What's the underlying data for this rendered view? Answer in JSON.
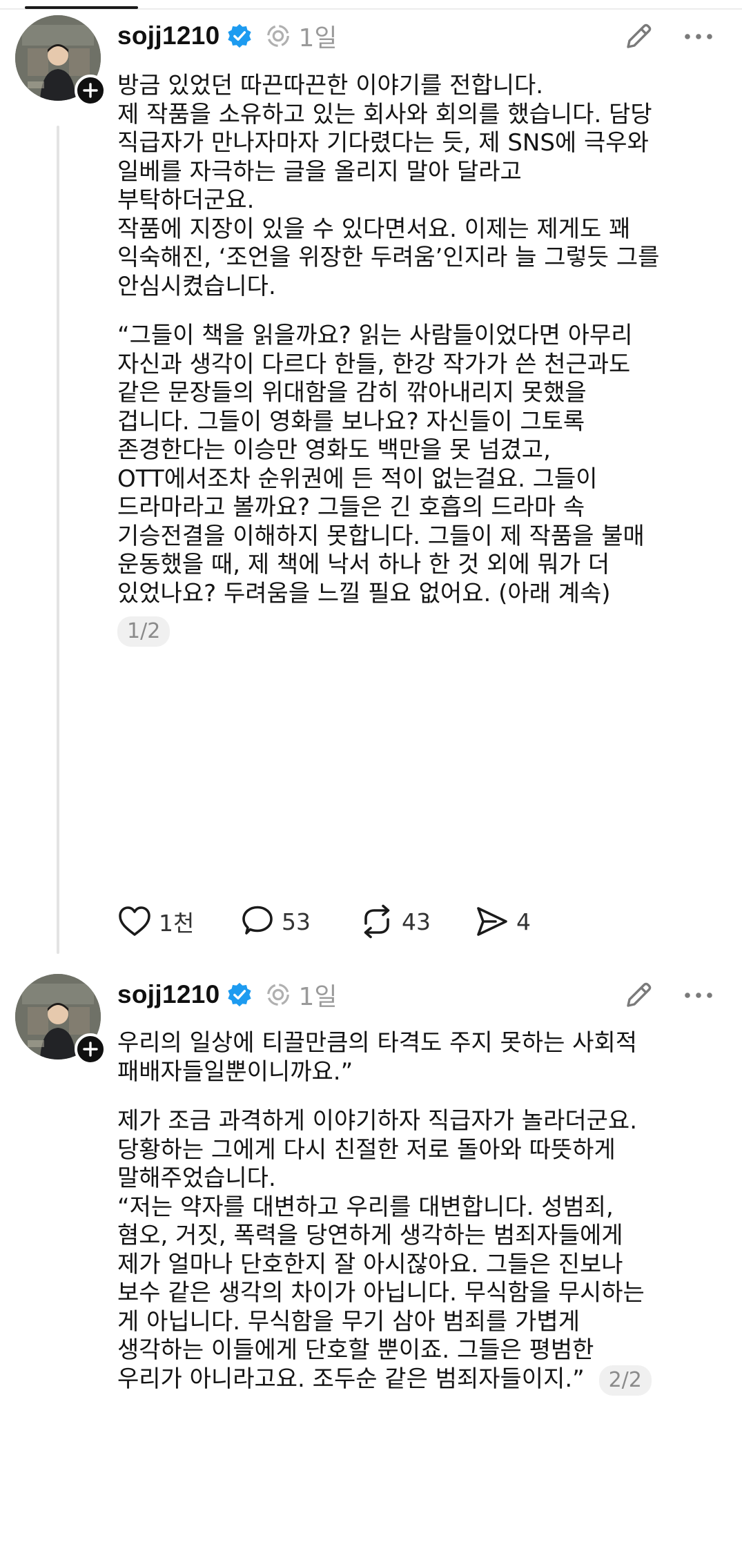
{
  "colors": {
    "text": "#141414",
    "muted": "#9a9a9a",
    "verified": "#1d9bf0",
    "badge_bg": "#f0f0f0"
  },
  "posts": [
    {
      "username": "sojj1210",
      "time": "1일",
      "icons": [
        "verified-icon",
        "ai-label-icon",
        "edit-icon",
        "more-icon",
        "follow-plus-icon"
      ],
      "paragraphs": [
        "방금 있었던 따끈따끈한 이야기를 전합니다.\n제 작품을 소유하고 있는 회사와 회의를 했습니다. 담당\n직급자가 만나자마자 기다렸다는 듯, 제 SNS에 극우와\n일베를 자극하는 글을 올리지 말아 달라고\n부탁하더군요.\n작품에 지장이 있을 수 있다면서요. 이제는 제게도 꽤\n익숙해진, ‘조언을 위장한 두려움’인지라 늘 그렇듯 그를\n안심시켰습니다.",
        "“그들이 책을 읽을까요? 읽는 사람들이었다면 아무리\n자신과 생각이 다르다 한들, 한강 작가가 쓴 천근과도\n같은 문장들의 위대함을 감히 깎아내리지 못했을\n겁니다. 그들이 영화를 보나요? 자신들이 그토록\n존경한다는 이승만 영화도 백만을 못 넘겼고,\nOTT에서조차 순위권에 든 적이 없는걸요. 그들이\n드라마라고 볼까요? 그들은 긴 호흡의 드라마 속\n기승전결을 이해하지 못합니다. 그들이 제 작품을 불매\n운동했을 때, 제 책에 낙서 하나 한 것 외에 뭐가 더\n있었나요? 두려움을 느낄 필요 없어요. (아래 계속)"
      ],
      "page_badge": "1/2",
      "actions": {
        "likes": "1천",
        "comments": "53",
        "reposts": "43",
        "shares": "4"
      }
    },
    {
      "username": "sojj1210",
      "time": "1일",
      "icons": [
        "verified-icon",
        "ai-label-icon",
        "edit-icon",
        "more-icon",
        "follow-plus-icon"
      ],
      "paragraphs": [
        "우리의 일상에 티끌만큼의 타격도 주지 못하는 사회적\n패배자들일뿐이니까요.”",
        "제가 조금 과격하게 이야기하자 직급자가 놀라더군요.\n당황하는 그에게 다시 친절한 저로 돌아와 따뜻하게\n말해주었습니다.",
        "“저는 약자를 대변하고 우리를 대변합니다. 성범죄,\n혐오, 거짓, 폭력을 당연하게 생각하는 범죄자들에게\n제가 얼마나 단호한지 잘 아시잖아요. 그들은 진보나\n보수 같은 생각의 차이가 아닙니다. 무식함을 무시하는\n게 아닙니다. 무식함을 무기 삼아 범죄를 가볍게\n생각하는 이들에게 단호할 뿐이죠. 그들은 평범한\n우리가 아니라고요. 조두순 같은 범죄자들이지.”"
      ],
      "page_badge": "2/2"
    }
  ]
}
